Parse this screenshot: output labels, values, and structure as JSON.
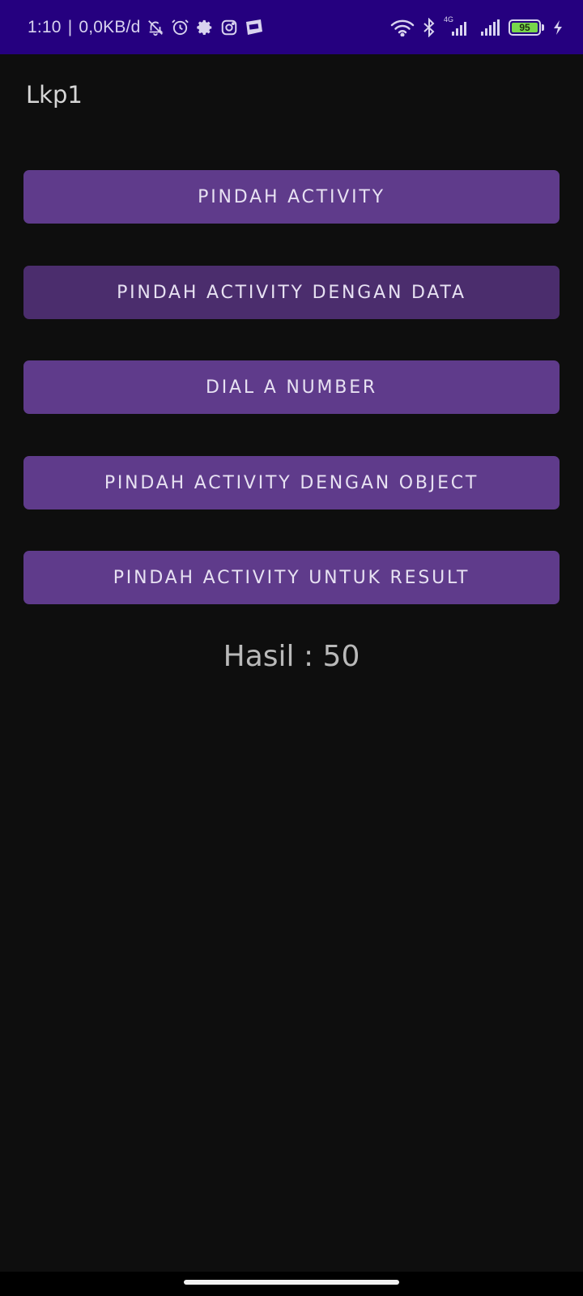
{
  "status_bar": {
    "time": "1:10",
    "separator": "|",
    "network_speed": "0,0KB/d",
    "left_icons": [
      "notifications-off-icon",
      "alarm-icon",
      "settings-gear-icon",
      "instagram-icon",
      "webtoon-icon"
    ],
    "right_icons": [
      "wifi-icon",
      "bluetooth-icon",
      "signal-4g-icon",
      "signal-icon",
      "battery-icon",
      "charging-icon"
    ],
    "network_type": "4G",
    "battery_level": "95",
    "background": "#25007f"
  },
  "app": {
    "title": "Lkp1"
  },
  "buttons": [
    {
      "label": "PINDAH ACTIVITY",
      "color": "#5f3b8b"
    },
    {
      "label": "PINDAH ACTIVITY DENGAN DATA",
      "color": "#4b2d6d"
    },
    {
      "label": "DIAL A NUMBER",
      "color": "#5f3b8b"
    },
    {
      "label": "PINDAH ACTIVITY DENGAN OBJECT",
      "color": "#5f3b8b"
    },
    {
      "label": "PINDAH ACTIVITY UNTUK RESULT",
      "color": "#5f3b8b"
    }
  ],
  "result": {
    "text": "Hasil : 50"
  },
  "theme": {
    "background": "#0e0e0e",
    "button_text": "#e7e1f2",
    "title_text": "#d6d6d6"
  }
}
